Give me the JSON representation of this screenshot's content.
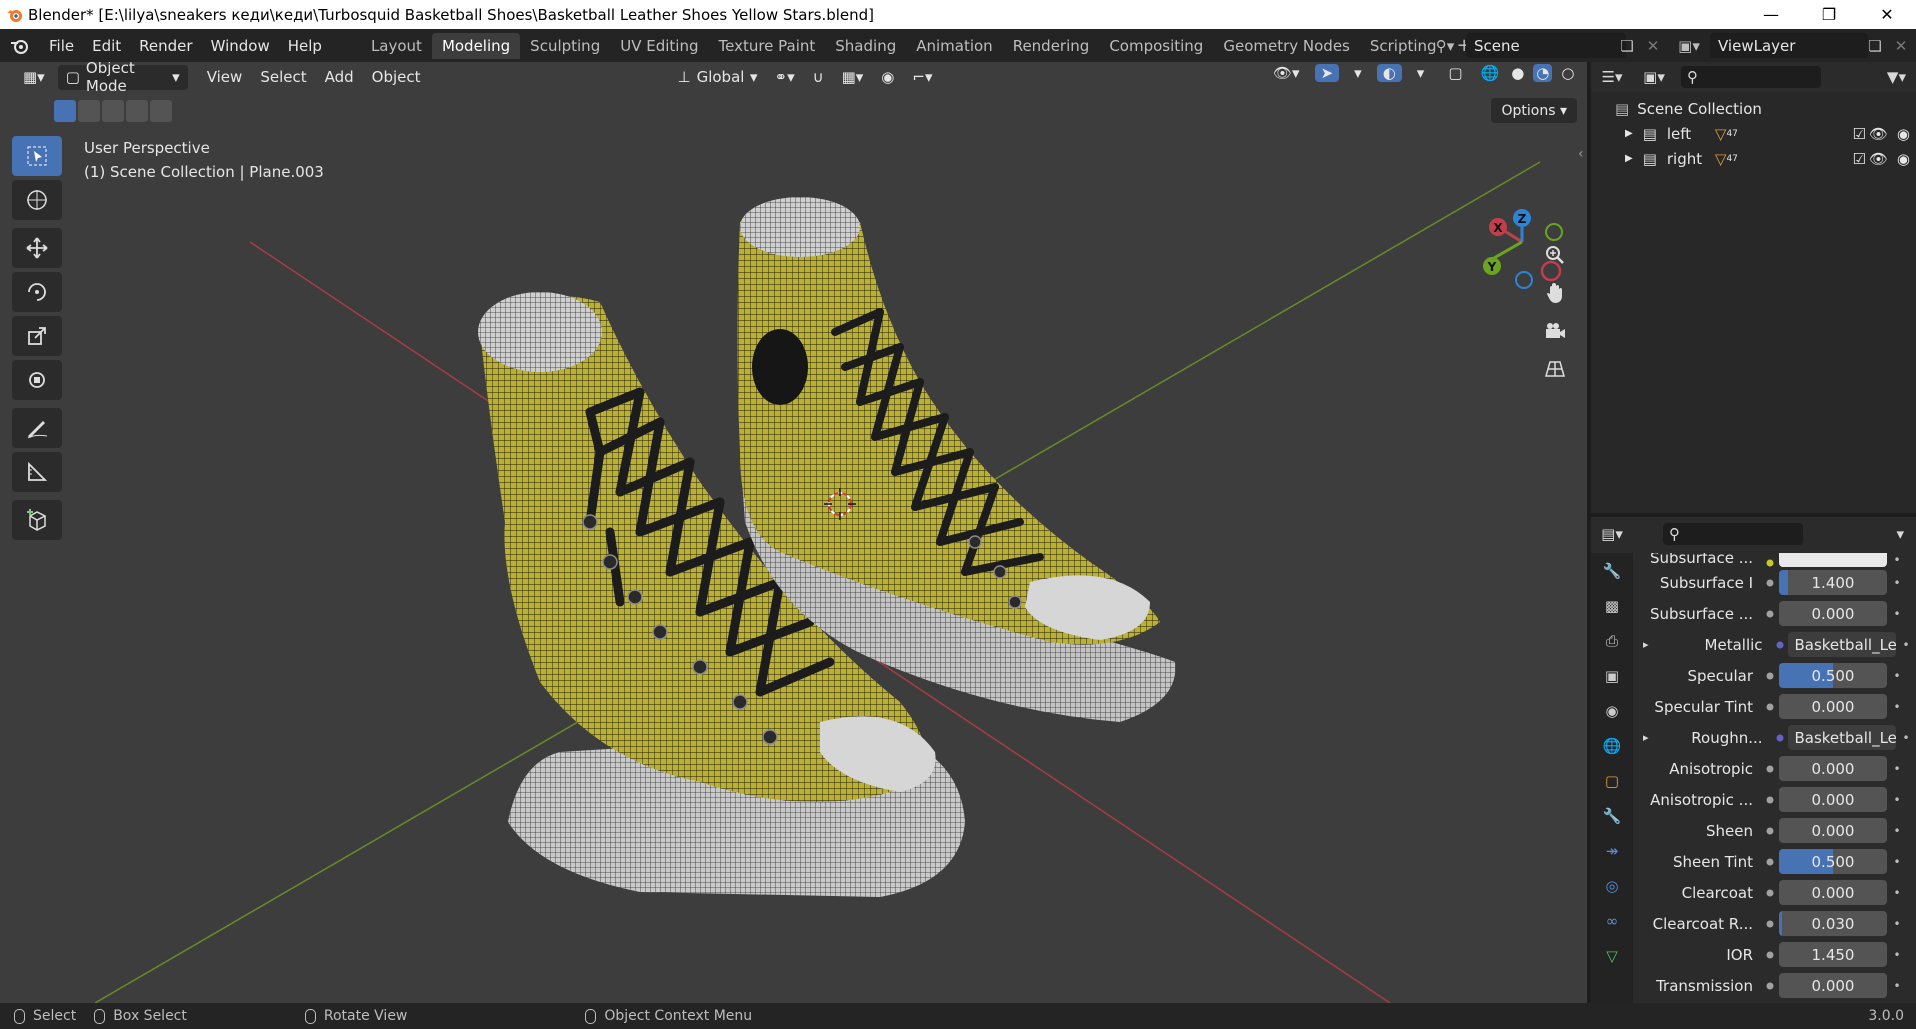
{
  "window": {
    "title": "Blender* [E:\\lilya\\sneakers кеди\\кеди\\Turbosquid Basketball Shoes\\Basketball Leather Shoes Yellow Stars.blend]",
    "minimize_icon": "minimize-icon",
    "maximize_icon": "restore-icon",
    "close_icon": "close-icon"
  },
  "menu": [
    "File",
    "Edit",
    "Render",
    "Window",
    "Help"
  ],
  "workspaces": [
    "Layout",
    "Modeling",
    "Sculpting",
    "UV Editing",
    "Texture Paint",
    "Shading",
    "Animation",
    "Rendering",
    "Compositing",
    "Geometry Nodes",
    "Scripting"
  ],
  "active_workspace": "Modeling",
  "scene": {
    "name": "Scene",
    "view_layer": "ViewLayer"
  },
  "viewport": {
    "mode": "Object Mode",
    "menus": [
      "View",
      "Select",
      "Add",
      "Object"
    ],
    "transform_orientation": "Global",
    "options_label": "Options",
    "view_name": "User Perspective",
    "context": "(1) Scene Collection | Plane.003",
    "gizmo_axes": {
      "x": "X",
      "y": "Y",
      "z": "Z"
    },
    "colors": {
      "x_axis": "#c33e4c",
      "y_axis": "#6ba41f",
      "z_axis": "#2f83d6",
      "shoe_yellow": "#b9b02e",
      "background": "#3d3d3d"
    }
  },
  "outliner": {
    "root": "Scene Collection",
    "collections": [
      {
        "name": "left",
        "count": "47"
      },
      {
        "name": "right",
        "count": "47"
      }
    ]
  },
  "properties": {
    "rows": [
      {
        "label": "Subsurface ...",
        "value": "",
        "fill": 0,
        "kind": "color"
      },
      {
        "label": "Subsurface I",
        "value": "1.400",
        "fill": 0.08,
        "kind": "number"
      },
      {
        "label": "Subsurface ...",
        "value": "0.000",
        "fill": 0,
        "kind": "number"
      },
      {
        "label": "Metallic",
        "value": "Basketball_Lea...",
        "fill": 0,
        "kind": "link"
      },
      {
        "label": "Specular",
        "value": "0.500",
        "fill": 0.5,
        "kind": "number"
      },
      {
        "label": "Specular Tint",
        "value": "0.000",
        "fill": 0,
        "kind": "number"
      },
      {
        "label": "Roughn...",
        "value": "Basketball_Lea...",
        "fill": 0,
        "kind": "link"
      },
      {
        "label": "Anisotropic",
        "value": "0.000",
        "fill": 0,
        "kind": "number"
      },
      {
        "label": "Anisotropic ...",
        "value": "0.000",
        "fill": 0,
        "kind": "number"
      },
      {
        "label": "Sheen",
        "value": "0.000",
        "fill": 0,
        "kind": "number"
      },
      {
        "label": "Sheen Tint",
        "value": "0.500",
        "fill": 0.5,
        "kind": "number"
      },
      {
        "label": "Clearcoat",
        "value": "0.000",
        "fill": 0,
        "kind": "number"
      },
      {
        "label": "Clearcoat R...",
        "value": "0.030",
        "fill": 0.03,
        "kind": "number"
      },
      {
        "label": "IOR",
        "value": "1.450",
        "fill": 0,
        "kind": "number"
      },
      {
        "label": "Transmission",
        "value": "0.000",
        "fill": 0,
        "kind": "number"
      }
    ]
  },
  "statusbar": {
    "select": "Select",
    "box_select": "Box Select",
    "rotate_view": "Rotate View",
    "context_menu": "Object Context Menu",
    "version": "3.0.0"
  }
}
